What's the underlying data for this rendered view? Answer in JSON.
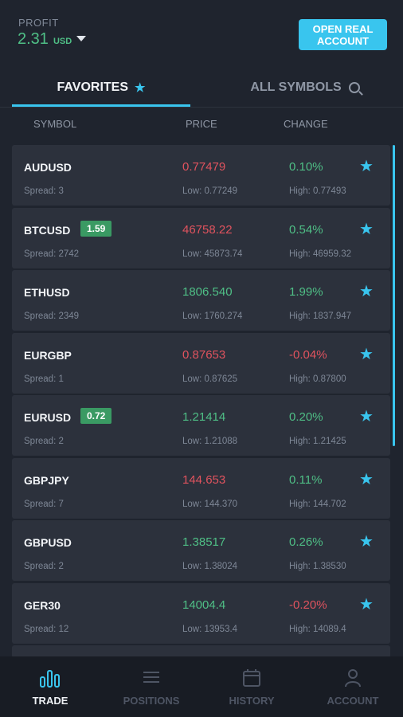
{
  "header": {
    "profit_label": "PROFIT",
    "profit_value": "2.31",
    "profit_currency": "USD",
    "open_account_label": "OPEN REAL ACCOUNT"
  },
  "tabs": {
    "favorites": "FAVORITES",
    "all_symbols": "ALL SYMBOLS"
  },
  "columns": {
    "symbol": "SYMBOL",
    "price": "PRICE",
    "change": "CHANGE"
  },
  "rows": [
    {
      "symbol": "AUDUSD",
      "badge": "",
      "price": "0.77479",
      "price_dir": "down",
      "change": "0.10%",
      "change_dir": "up",
      "spread": "Spread: 3",
      "low": "Low: 0.77249",
      "high": "High: 0.77493"
    },
    {
      "symbol": "BTCUSD",
      "badge": "1.59",
      "price": "46758.22",
      "price_dir": "down",
      "change": "0.54%",
      "change_dir": "up",
      "spread": "Spread: 2742",
      "low": "Low: 45873.74",
      "high": "High: 46959.32"
    },
    {
      "symbol": "ETHUSD",
      "badge": "",
      "price": "1806.540",
      "price_dir": "up",
      "change": "1.99%",
      "change_dir": "up",
      "spread": "Spread: 2349",
      "low": "Low: 1760.274",
      "high": "High: 1837.947"
    },
    {
      "symbol": "EURGBP",
      "badge": "",
      "price": "0.87653",
      "price_dir": "down",
      "change": "-0.04%",
      "change_dir": "down",
      "spread": "Spread: 1",
      "low": "Low: 0.87625",
      "high": "High: 0.87800"
    },
    {
      "symbol": "EURUSD",
      "badge": "0.72",
      "price": "1.21414",
      "price_dir": "up",
      "change": "0.20%",
      "change_dir": "up",
      "spread": "Spread: 2",
      "low": "Low: 1.21088",
      "high": "High: 1.21425"
    },
    {
      "symbol": "GBPJPY",
      "badge": "",
      "price": "144.653",
      "price_dir": "down",
      "change": "0.11%",
      "change_dir": "up",
      "spread": "Spread: 7",
      "low": "Low: 144.370",
      "high": "High: 144.702"
    },
    {
      "symbol": "GBPUSD",
      "badge": "",
      "price": "1.38517",
      "price_dir": "up",
      "change": "0.26%",
      "change_dir": "up",
      "spread": "Spread: 2",
      "low": "Low: 1.38024",
      "high": "High: 1.38530"
    },
    {
      "symbol": "GER30",
      "badge": "",
      "price": "14004.4",
      "price_dir": "up",
      "change": "-0.20%",
      "change_dir": "down",
      "spread": "Spread: 12",
      "low": "Low: 13953.4",
      "high": "High: 14089.4"
    }
  ],
  "nav": {
    "trade": "TRADE",
    "positions": "POSITIONS",
    "history": "HISTORY",
    "account": "ACCOUNT"
  },
  "colors": {
    "accent": "#39c5ee",
    "up": "#4fbf86",
    "down": "#e0535e",
    "background": "#1f242e",
    "card": "#2c313c"
  }
}
